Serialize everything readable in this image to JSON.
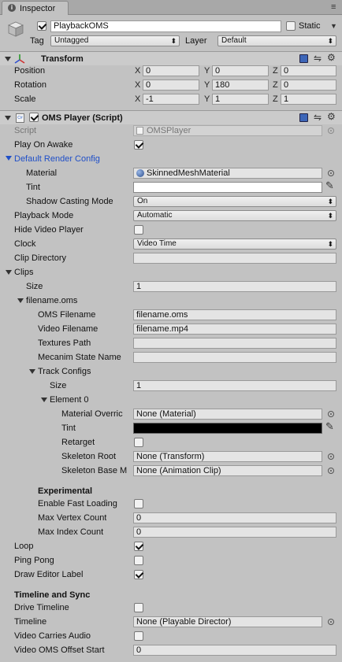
{
  "window": {
    "tab_title": "Inspector"
  },
  "gameobject": {
    "name": "PlaybackOMS",
    "active": true,
    "static_label": "Static",
    "static_checked": false,
    "tag_label": "Tag",
    "tag_value": "Untagged",
    "layer_label": "Layer",
    "layer_value": "Default"
  },
  "transform": {
    "title": "Transform",
    "rows": [
      {
        "label": "Position",
        "x": "0",
        "y": "0",
        "z": "0"
      },
      {
        "label": "Rotation",
        "x": "0",
        "y": "180",
        "z": "0"
      },
      {
        "label": "Scale",
        "x": "-1",
        "y": "1",
        "z": "1"
      }
    ],
    "axis": {
      "x": "X",
      "y": "Y",
      "z": "Z"
    }
  },
  "component": {
    "title": "OMS Player (Script)",
    "enabled": true,
    "script_label": "Script",
    "script_value": "OMSPlayer",
    "play_on_awake_label": "Play On Awake",
    "play_on_awake": true,
    "render_config_label": "Default Render Config",
    "material_label": "Material",
    "material_value": "SkinnedMeshMaterial",
    "tint_label": "Tint",
    "tint_color": "#ffffff",
    "shadow_label": "Shadow Casting Mode",
    "shadow_value": "On",
    "playback_mode_label": "Playback Mode",
    "playback_mode_value": "Automatic",
    "hide_video_label": "Hide Video Player",
    "hide_video": false,
    "clock_label": "Clock",
    "clock_value": "Video Time",
    "clip_dir_label": "Clip Directory",
    "clip_dir_value": "",
    "clips_label": "Clips",
    "size_label": "Size",
    "clips_size": "1",
    "clip_item_label": "filename.oms",
    "oms_filename_label": "OMS Filename",
    "oms_filename_value": "filename.oms",
    "video_filename_label": "Video Filename",
    "video_filename_value": "filename.mp4",
    "textures_path_label": "Textures Path",
    "textures_path_value": "",
    "mecanim_label": "Mecanim State Name",
    "mecanim_value": "",
    "track_configs_label": "Track Configs",
    "track_size": "1",
    "element_label": "Element 0",
    "material_override_label": "Material Overric",
    "material_override_value": "None (Material)",
    "element_tint_label": "Tint",
    "element_tint_color": "#000000",
    "retarget_label": "Retarget",
    "retarget": false,
    "skeleton_root_label": "Skeleton Root",
    "skeleton_root_value": "None (Transform)",
    "skeleton_base_label": "Skeleton Base M",
    "skeleton_base_value": "None (Animation Clip)",
    "experimental_label": "Experimental",
    "fast_loading_label": "Enable Fast Loading",
    "fast_loading": false,
    "max_vertex_label": "Max Vertex Count",
    "max_vertex_value": "0",
    "max_index_label": "Max Index Count",
    "max_index_value": "0",
    "loop_label": "Loop",
    "loop": true,
    "ping_pong_label": "Ping Pong",
    "ping_pong": false,
    "draw_editor_label": "Draw Editor Label",
    "draw_editor": true,
    "timeline_sync_label": "Timeline and Sync",
    "drive_timeline_label": "Drive Timeline",
    "drive_timeline": false,
    "timeline_label": "Timeline",
    "timeline_value": "None (Playable Director)",
    "video_audio_label": "Video Carries Audio",
    "video_audio": false,
    "video_offset_label": "Video OMS Offset Start",
    "video_offset_value": "0"
  }
}
